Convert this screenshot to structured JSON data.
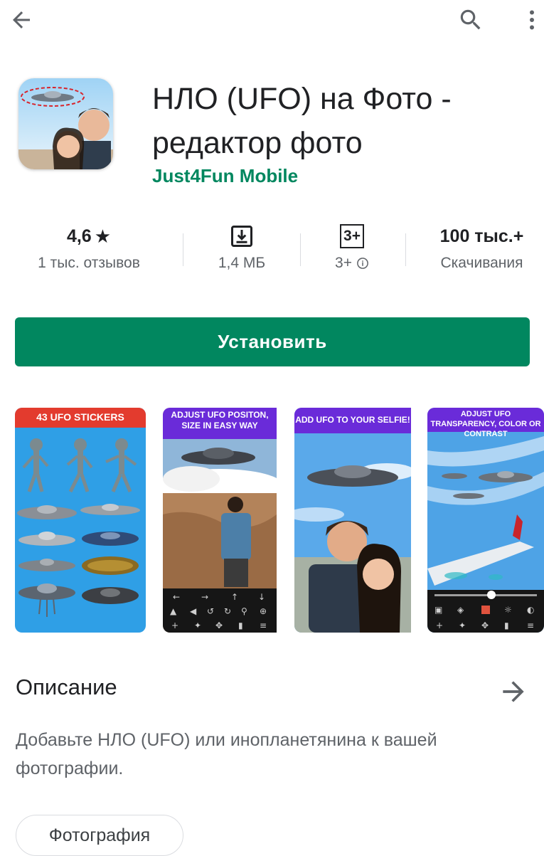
{
  "app": {
    "title": "НЛО (UFO) на Фото - редактор фото",
    "developer": "Just4Fun Mobile"
  },
  "stats": {
    "rating_value": "4,6",
    "rating_star": "★",
    "rating_label": "1 тыс. отзывов",
    "size_label": "1,4 МБ",
    "age_badge": "3+",
    "age_label": "3+",
    "downloads_value": "100 тыс.+",
    "downloads_label": "Скачивания"
  },
  "install_label": "Установить",
  "screenshots": {
    "s1_caption": "43 UFO STICKERS",
    "s2_caption": "ADJUST UFO POSITON, SIZE IN EASY WAY",
    "s3_caption": "ADD UFO TO YOUR SELFIE!",
    "s4_caption": "ADJUST UFO TRANSPARENCY, COLOR OR CONTRAST"
  },
  "description": {
    "heading": "Описание",
    "text": "Добавьте НЛО (UFO) или инопланетянина к вашей фотографии."
  },
  "category_chip": "Фотография",
  "colors": {
    "accent": "#01875f",
    "text_secondary": "#5f6368"
  },
  "icons": [
    "back-arrow-icon",
    "search-icon",
    "more-vert-icon",
    "star-icon",
    "download-icon",
    "info-icon",
    "arrow-right-icon"
  ]
}
